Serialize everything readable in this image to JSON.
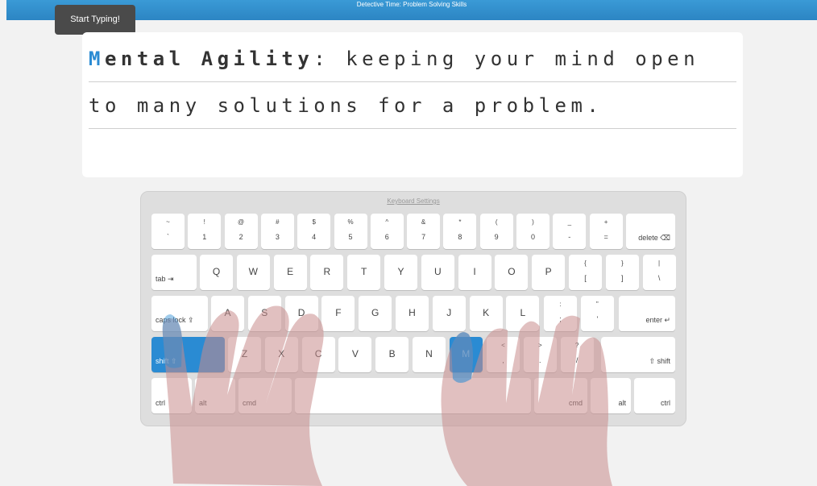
{
  "header": {
    "title": "Detective Time: Problem Solving Skills"
  },
  "tooltip": {
    "text": "Start Typing!"
  },
  "lesson": {
    "line1": {
      "current_char": "M",
      "bold_rest": "ental Agility",
      "rest": ": keeping your mind open"
    },
    "line2": "to many solutions for a problem."
  },
  "keyboard": {
    "settings_link": "Keyboard Settings",
    "active_keys": [
      "shift-left",
      "M"
    ],
    "accent_color": "#2a8bd3",
    "row1": [
      {
        "top": "~",
        "bot": "`"
      },
      {
        "top": "!",
        "bot": "1"
      },
      {
        "top": "@",
        "bot": "2"
      },
      {
        "top": "#",
        "bot": "3"
      },
      {
        "top": "$",
        "bot": "4"
      },
      {
        "top": "%",
        "bot": "5"
      },
      {
        "top": "^",
        "bot": "6"
      },
      {
        "top": "&",
        "bot": "7"
      },
      {
        "top": "*",
        "bot": "8"
      },
      {
        "top": "(",
        "bot": "9"
      },
      {
        "top": ")",
        "bot": "0"
      },
      {
        "top": "_",
        "bot": "-"
      },
      {
        "top": "+",
        "bot": "="
      }
    ],
    "delete_label": "delete ⌫",
    "tab_label": "tab ⇥",
    "row2": [
      "Q",
      "W",
      "E",
      "R",
      "T",
      "Y",
      "U",
      "I",
      "O",
      "P"
    ],
    "row2_sym": [
      {
        "top": "{",
        "bot": "["
      },
      {
        "top": "}",
        "bot": "]"
      },
      {
        "top": "|",
        "bot": "\\"
      }
    ],
    "caps_label": "caps lock ⇪",
    "row3": [
      "A",
      "S",
      "D",
      "F",
      "G",
      "H",
      "J",
      "K",
      "L"
    ],
    "row3_sym": [
      {
        "top": ":",
        "bot": ";"
      },
      {
        "top": "\"",
        "bot": "'"
      }
    ],
    "enter_label": "enter ↵",
    "shift_left_label": "shift ⇧",
    "row4": [
      "Z",
      "X",
      "C",
      "V",
      "B",
      "N",
      "M"
    ],
    "row4_sym": [
      {
        "top": "<",
        "bot": ","
      },
      {
        "top": ">",
        "bot": "."
      },
      {
        "top": "?",
        "bot": "/"
      }
    ],
    "shift_right_label": "⇧ shift",
    "bottom": {
      "ctrl": "ctrl",
      "alt": "alt",
      "cmd": "cmd"
    }
  }
}
